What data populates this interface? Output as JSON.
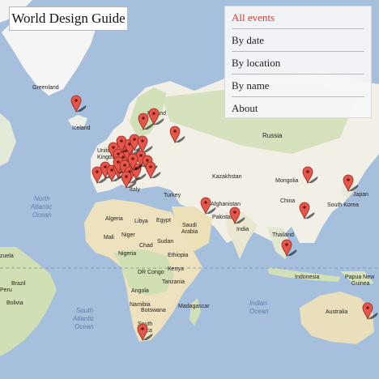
{
  "app": {
    "title": "World Design Guide"
  },
  "menu": {
    "items": [
      {
        "label": "All events",
        "active": true
      },
      {
        "label": "By date",
        "active": false
      },
      {
        "label": "By location",
        "active": false
      },
      {
        "label": "By name",
        "active": false
      },
      {
        "label": "About",
        "active": false
      }
    ]
  },
  "map": {
    "colors": {
      "water": "#a5bfdd",
      "land": "#f2efe6",
      "forest": "#cfdfb2",
      "desert": "#ede0b7",
      "pin": "#e8554a",
      "accent": "#e8372d"
    },
    "icon": "map-marker-icon",
    "labels": {
      "greenland": "Greenland",
      "iceland": "Iceland",
      "finland": "Finland",
      "russia": "Russia",
      "kazakhstan": "Kazakhstan",
      "mongolia": "Mongolia",
      "china": "China",
      "japan": "Japan",
      "south_korea": "South Korea",
      "afghanistan": "Afghanistan",
      "pakistan": "Pakistan",
      "india": "India",
      "thailand": "Thailand",
      "indonesia": "Indonesia",
      "papua": "Papua New",
      "papua2": "Guinea",
      "australia": "Australia",
      "italy": "Italy",
      "turkey": "Turkey",
      "algeria": "Algeria",
      "libya": "Libya",
      "egypt": "Egypt",
      "saudi": "Saudi",
      "saudi2": "Arabia",
      "mali": "Mali",
      "niger": "Niger",
      "chad": "Chad",
      "sudan": "Sudan",
      "nigeria": "Nigeria",
      "ethiopia": "Ethiopia",
      "kenya": "Kenya",
      "drc": "DR Congo",
      "tanzania": "Tanzania",
      "angola": "Angola",
      "namibia": "Namibia",
      "botswana": "Botswana",
      "madagascar": "Madagascar",
      "south_africa": "South",
      "south_africa2": "Africa",
      "uk": "Unite",
      "uk2": "Kingd",
      "venezuela": "zuela",
      "brazil": "Brazil",
      "peru": "Peru",
      "bolivia": "Bolivia",
      "north_atlantic": "North",
      "north_atlantic2": "Atlantic",
      "north_atlantic3": "Ocean",
      "south_atlantic": "South",
      "south_atlantic2": "Atlantic",
      "south_atlantic3": "Ocean",
      "indian": "Indian",
      "indian2": "Ocean"
    }
  }
}
